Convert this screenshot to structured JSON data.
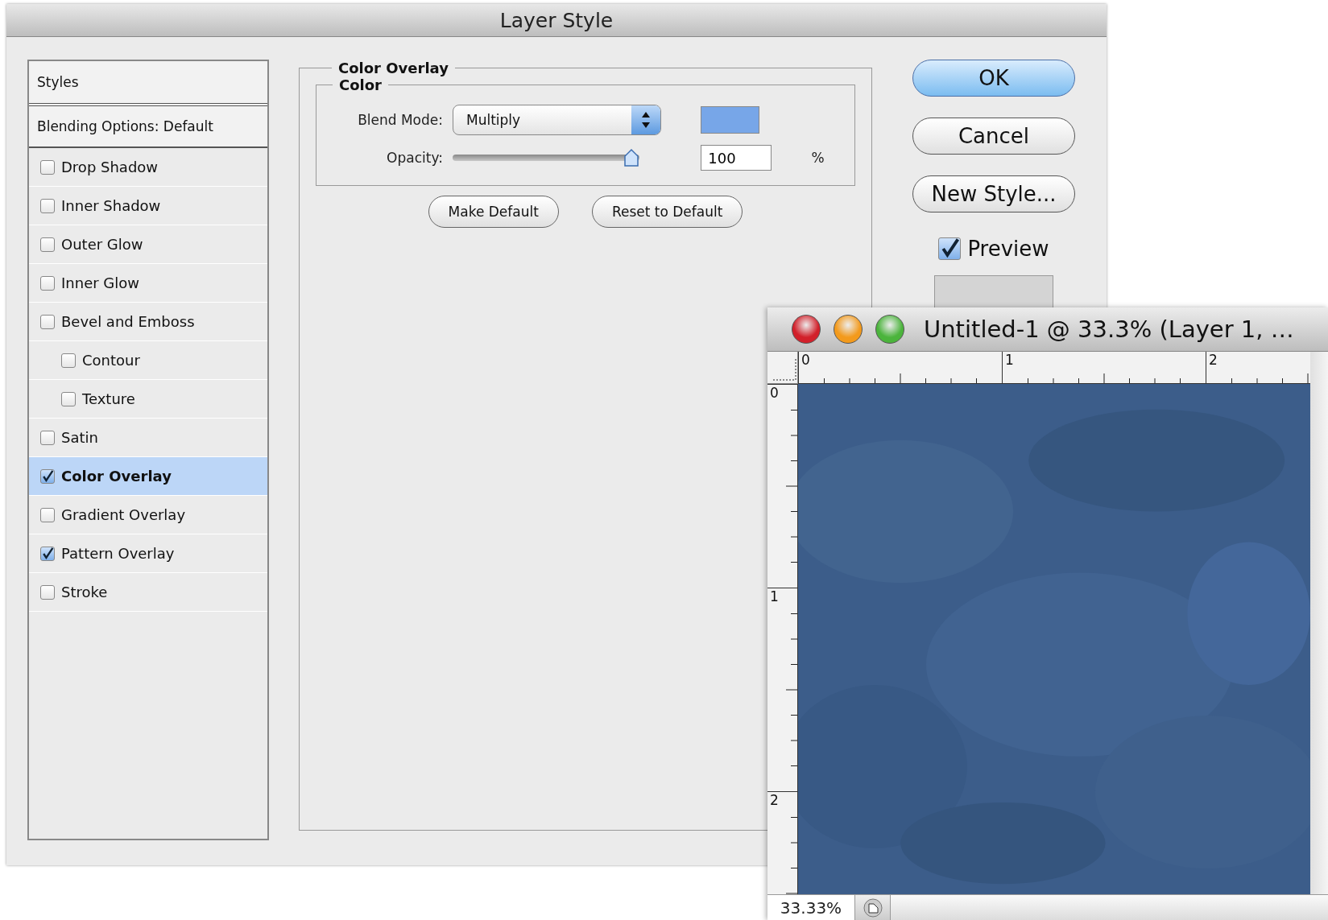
{
  "dialog": {
    "title": "Layer Style",
    "styles_list": {
      "header": "Styles",
      "blending": "Blending Options: Default",
      "items": [
        {
          "label": "Drop Shadow",
          "checked": false,
          "selected": false
        },
        {
          "label": "Inner Shadow",
          "checked": false,
          "selected": false
        },
        {
          "label": "Outer Glow",
          "checked": false,
          "selected": false
        },
        {
          "label": "Inner Glow",
          "checked": false,
          "selected": false
        },
        {
          "label": "Bevel and Emboss",
          "checked": false,
          "selected": false,
          "children": [
            {
              "label": "Contour",
              "checked": false,
              "selected": false
            },
            {
              "label": "Texture",
              "checked": false,
              "selected": false
            }
          ]
        },
        {
          "label": "Satin",
          "checked": false,
          "selected": false
        },
        {
          "label": "Color Overlay",
          "checked": true,
          "selected": true
        },
        {
          "label": "Gradient Overlay",
          "checked": false,
          "selected": false
        },
        {
          "label": "Pattern Overlay",
          "checked": true,
          "selected": false
        },
        {
          "label": "Stroke",
          "checked": false,
          "selected": false
        }
      ]
    },
    "panel": {
      "title": "Color Overlay",
      "group_title": "Color",
      "blend_mode_label": "Blend Mode:",
      "blend_mode": "Multiply",
      "color": "#77a6e8",
      "opacity_label": "Opacity:",
      "opacity": {
        "level": 1
      },
      "opacity_value": "100",
      "opacity_unit": "%",
      "buttons": [
        "Make Default",
        "Reset to Default"
      ]
    },
    "buttons": [
      {
        "label": "OK",
        "default": true
      },
      {
        "label": "Cancel",
        "default": false
      },
      {
        "label": "New Style...",
        "default": false
      }
    ],
    "preview": {
      "label": "Preview",
      "checked": true
    }
  },
  "document": {
    "title": "Untitled-1 @ 33.3% (Layer 1, …",
    "top_ruler": [
      "0",
      "1",
      "2"
    ],
    "left_ruler": [
      "0",
      "1",
      "2"
    ],
    "zoom": "33.33%"
  }
}
